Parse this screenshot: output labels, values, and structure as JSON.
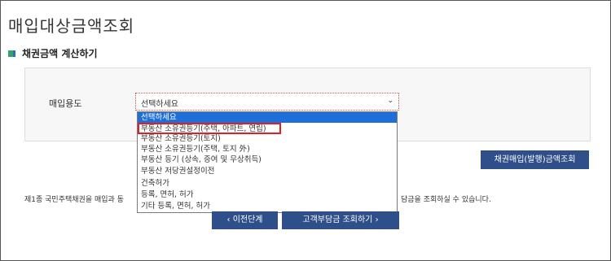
{
  "page": {
    "title": "매입대상금액조회"
  },
  "section": {
    "title": "채권금액 계산하기"
  },
  "form": {
    "purpose_label": "매입용도",
    "select": {
      "value": "선택하세요",
      "options": [
        "선택하세요",
        "부동산 소유권등기(주택, 아파트, 연립)",
        "부동산 소유권등기(토지)",
        "부동산 소유권등기(주택, 토지 外)",
        "부동산 등기 (상속, 증여 및 무상취득)",
        "부동산 저당권설정이전",
        "건축허가",
        "등록, 면허, 허가",
        "기타 등록, 면허, 허가"
      ],
      "highlighted_option_index": 1
    }
  },
  "buttons": {
    "bond_lookup": "채권매입(발행)금액조회",
    "prev": "이전단계",
    "next": "고객부담금 조회하기"
  },
  "notice": {
    "left": "제1종 국민주택채권을 매입과 동",
    "right": "담금을 조회하실 수 있습니다."
  },
  "colors": {
    "button_blue": "#2f4f8a",
    "option_selected": "#1e6fd9",
    "highlight_red": "#e02020"
  }
}
